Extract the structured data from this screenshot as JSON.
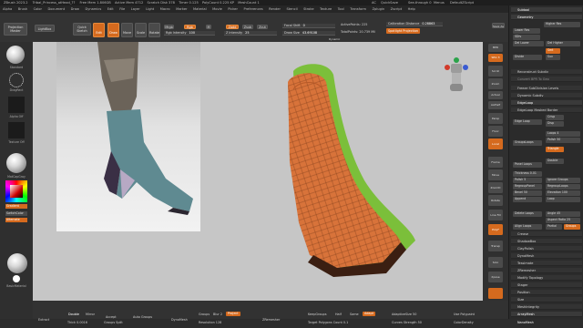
{
  "window": {
    "title": "ZBrush 2023.2",
    "doc": "Tribal_Princess_atHead_??",
    "stats": [
      "Free Mem 1.806GB",
      "Active Mem 4712",
      "Scratch Disk 378",
      "Timer 0.125",
      "PolyCount 0.225 KP",
      "MeshCount 1"
    ],
    "right": [
      "AC",
      "QuickSave",
      "See-through 0",
      "Menus",
      "DefaultZScript"
    ]
  },
  "menu": {
    "items": [
      "Alpha",
      "Brush",
      "Color",
      "Document",
      "Draw",
      "Dynamics",
      "Edit",
      "File",
      "Layer",
      "Light",
      "Macro",
      "Marker",
      "Material",
      "Movie",
      "Picker",
      "Preferences",
      "Render",
      "Stencil",
      "Stroke",
      "Texture",
      "Tool",
      "Transform",
      "Zplugin",
      "Zscript",
      "Help"
    ]
  },
  "shelf": {
    "projection_master": "Projection\nMaster",
    "lightbox": "LightBox",
    "quick_sketch": "Quick\nSketch",
    "edit": "Edit",
    "draw": "Draw",
    "move": "Move",
    "scale": "Scale",
    "rotate": "Rotate",
    "mrgb": "Mrgb",
    "rgb": "Rgb",
    "m": "M",
    "rgb_intensity": "Rgb Intensity",
    "rgb_intensity_val": "100",
    "zadd": "Zadd",
    "zsub": "Zsub",
    "zcut": "Zcut",
    "z_intensity": "Z Intensity",
    "z_intensity_val": "25",
    "focal_shift": "Focal Shift",
    "focal_shift_val": "0",
    "draw_size": "Draw Size",
    "draw_size_val": "43.69108",
    "dynamic": "Dynamic",
    "active_points": "ActivePoints:",
    "active_points_val": "225",
    "total_points": "TotalPoints:",
    "total_points_val": "20.739 Mil",
    "calib_distance": "Calibration Distance",
    "calib_distance_val": "0.28863",
    "spotlight": "Spotlight Projection",
    "save_as": "Save As",
    "quick_save": "QuickSave"
  },
  "left": {
    "standard": "Standard",
    "dots": "DragRect",
    "alpha_off": "Alpha Off",
    "texture_off": "Texture Off",
    "matcap": "MatCapGray",
    "gradient": "Gradient",
    "switch_color": "SwitchColor",
    "alternate": "Alternate",
    "basic_material": "BasicMaterial"
  },
  "right_shelf": {
    "items": [
      "BPR",
      "SPix 3",
      "Scroll",
      "Zoom",
      "Actual",
      "AAHalf",
      "Persp",
      "Floor",
      "Local",
      "Frame",
      "Move",
      "ZoomD",
      "Rotate",
      "Line Fill",
      "PolyF",
      "Transp",
      "Solo",
      "Xpose"
    ]
  },
  "tray": {
    "submenu": "Subtool",
    "geometry": "Geometry",
    "higher_res": "Higher Res",
    "lower_res": "Lower Res",
    "sdiv": "SDiv",
    "del_lower": "Del Lower",
    "del_higher": "Del Higher",
    "divide": "Divide",
    "smt": "Smt",
    "suv": "Suv",
    "reconstruct": "Reconstruct Subdiv",
    "convert_bpr": "Convert BPR To Geo",
    "freeze": "Freeze SubDivision Levels",
    "dynamic_subdiv": "Dynamic Subdiv",
    "edgeloop": "EdgeLoop",
    "edgeloop_masked": "EdgeLoop Masked Border",
    "crisp": "Crisp",
    "edge_loop": "Edge Loop",
    "disp": "Disp",
    "loops": "Loops",
    "loops_val": "4",
    "polish": "Polish",
    "polish_val": "50",
    "triangle": "Triangle",
    "group_loops": "GroupsLoops",
    "double": "Double",
    "panel_loops": "Panel Loops",
    "thickness": "Thickness",
    "thickness_val": "0.01",
    "polish2": "Polish",
    "polish2_val": "5",
    "bevel": "Bevel",
    "bevel_val": "50",
    "ignore_groups": "Ignore Groups",
    "elevation": "Elevation",
    "elevation_val": "100",
    "regroup_panel": "RegroupPanel",
    "regroup_loops": "RegroupLoops",
    "append": "Append",
    "new_loop": "Loop",
    "delete_loops": "Delete Loops",
    "align_loops": "Align Loops",
    "angle": "Angle",
    "angle_val": "45",
    "aspect_ratio": "Aspect Ratio",
    "aspect_ratio_val": "25",
    "partial": "Partial",
    "groups": "Groups",
    "crease": "Crease",
    "shadowbox": "ShadowBox",
    "claypolish": "ClayPolish",
    "dynamesh": "DynaMesh",
    "tessimate": "Tessimate",
    "zremesher": "ZRemesher",
    "modify_topology": "Modify Topology",
    "stager": "Stager",
    "position": "Position",
    "size": "Size",
    "meshintegrity": "MeshIntegrity",
    "arraymesh": "ArrayMesh",
    "nanomesh": "NanoMesh"
  },
  "viewport": {
    "mirror_and_weld": "Mirror And Weld",
    "backface_mask": "BackfaceMask",
    "close_holes": "Close Holes",
    "del_hidden": "Del Hidden",
    "inflate": "Inflate",
    "size": "Size",
    "lazymouse": "LazyMouse"
  },
  "bottom": {
    "double": "Double",
    "mirror": "Mirror",
    "extract": "Extract",
    "thick": "Thick",
    "thick_val": "0.0016",
    "accept": "Accept",
    "groups_split": "Groups Split",
    "auto_groups": "Auto Groups",
    "dynamesh": "DynaMesh",
    "groups": "Groups",
    "blur": "Blur",
    "blur_val": "2",
    "project": "Project",
    "resolution": "Resolution",
    "resolution_val": "128",
    "zremesher": "ZRemesher",
    "keep_groups": "KeepGroups",
    "half": "Half",
    "same": "Same",
    "adapt": "Adapt",
    "target_polygons": "Target Polygons Count",
    "target_polygons_val": "0.1",
    "adaptive_size": "AdaptiveSize",
    "adaptive_size_val": "50",
    "curves_strength": "Curves Strength",
    "curves_strength_val": "50",
    "use_polypaint": "Use Polypaint",
    "color_density": "ColorDensity"
  },
  "colors": {
    "accent": "#d56a1e",
    "mesh": "#d8733a",
    "green": "#7bbf3a",
    "bg": "#c6c6c6"
  }
}
